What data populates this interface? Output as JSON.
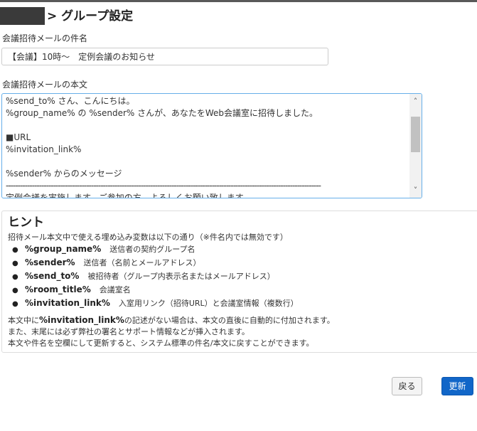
{
  "header": {
    "title": "> グループ設定"
  },
  "subject": {
    "label": "会議招待メールの件名",
    "value": "【会議】10時～　定例会議のお知らせ"
  },
  "body": {
    "label": "会議招待メールの本文",
    "lines": [
      "%send_to% さん、こんにちは。",
      "%group_name% の %sender% さんが、あなたをWeb会議室に招待しました。",
      "",
      "■URL",
      "%invitation_link%",
      "",
      "%sender% からのメッセージ",
      "-------------------------------------------------------------------------------------------------------------------------------------",
      "定例会議を実施します。ご参加の方、よろしくお願い致します。"
    ]
  },
  "hint": {
    "title": "ヒント",
    "intro": "招待メール本文中で使える埋め込み変数は以下の通り（※件名内では無効です）",
    "variables": [
      {
        "name": "%group_name%",
        "desc": "送信者の契約グループ名"
      },
      {
        "name": "%sender%",
        "desc": "送信者（名前とメールアドレス）"
      },
      {
        "name": "%send_to%",
        "desc": "被招待者（グループ内表示名またはメールアドレス）"
      },
      {
        "name": "%room_title%",
        "desc": "会議室名"
      },
      {
        "name": "%invitation_link%",
        "desc": "入室用リンク（招待URL）と会議室情報（複数行）"
      }
    ],
    "note1_prefix": "本文中に",
    "note1_var": "%invitation_link%",
    "note1_suffix": "の記述がない場合は、本文の直後に自動的に付加されます。",
    "note2": "また、末尾には必ず弊社の署名とサポート情報などが挿入されます。",
    "note3": "本文や件名を空欄にして更新すると、システム標準の件名/本文に戻すことができます。"
  },
  "buttons": {
    "back": "戻る",
    "update": "更新"
  },
  "colors": {
    "primary": "#1166c8",
    "focus_border": "#66afe9",
    "header_bar": "#3a3a3a"
  }
}
